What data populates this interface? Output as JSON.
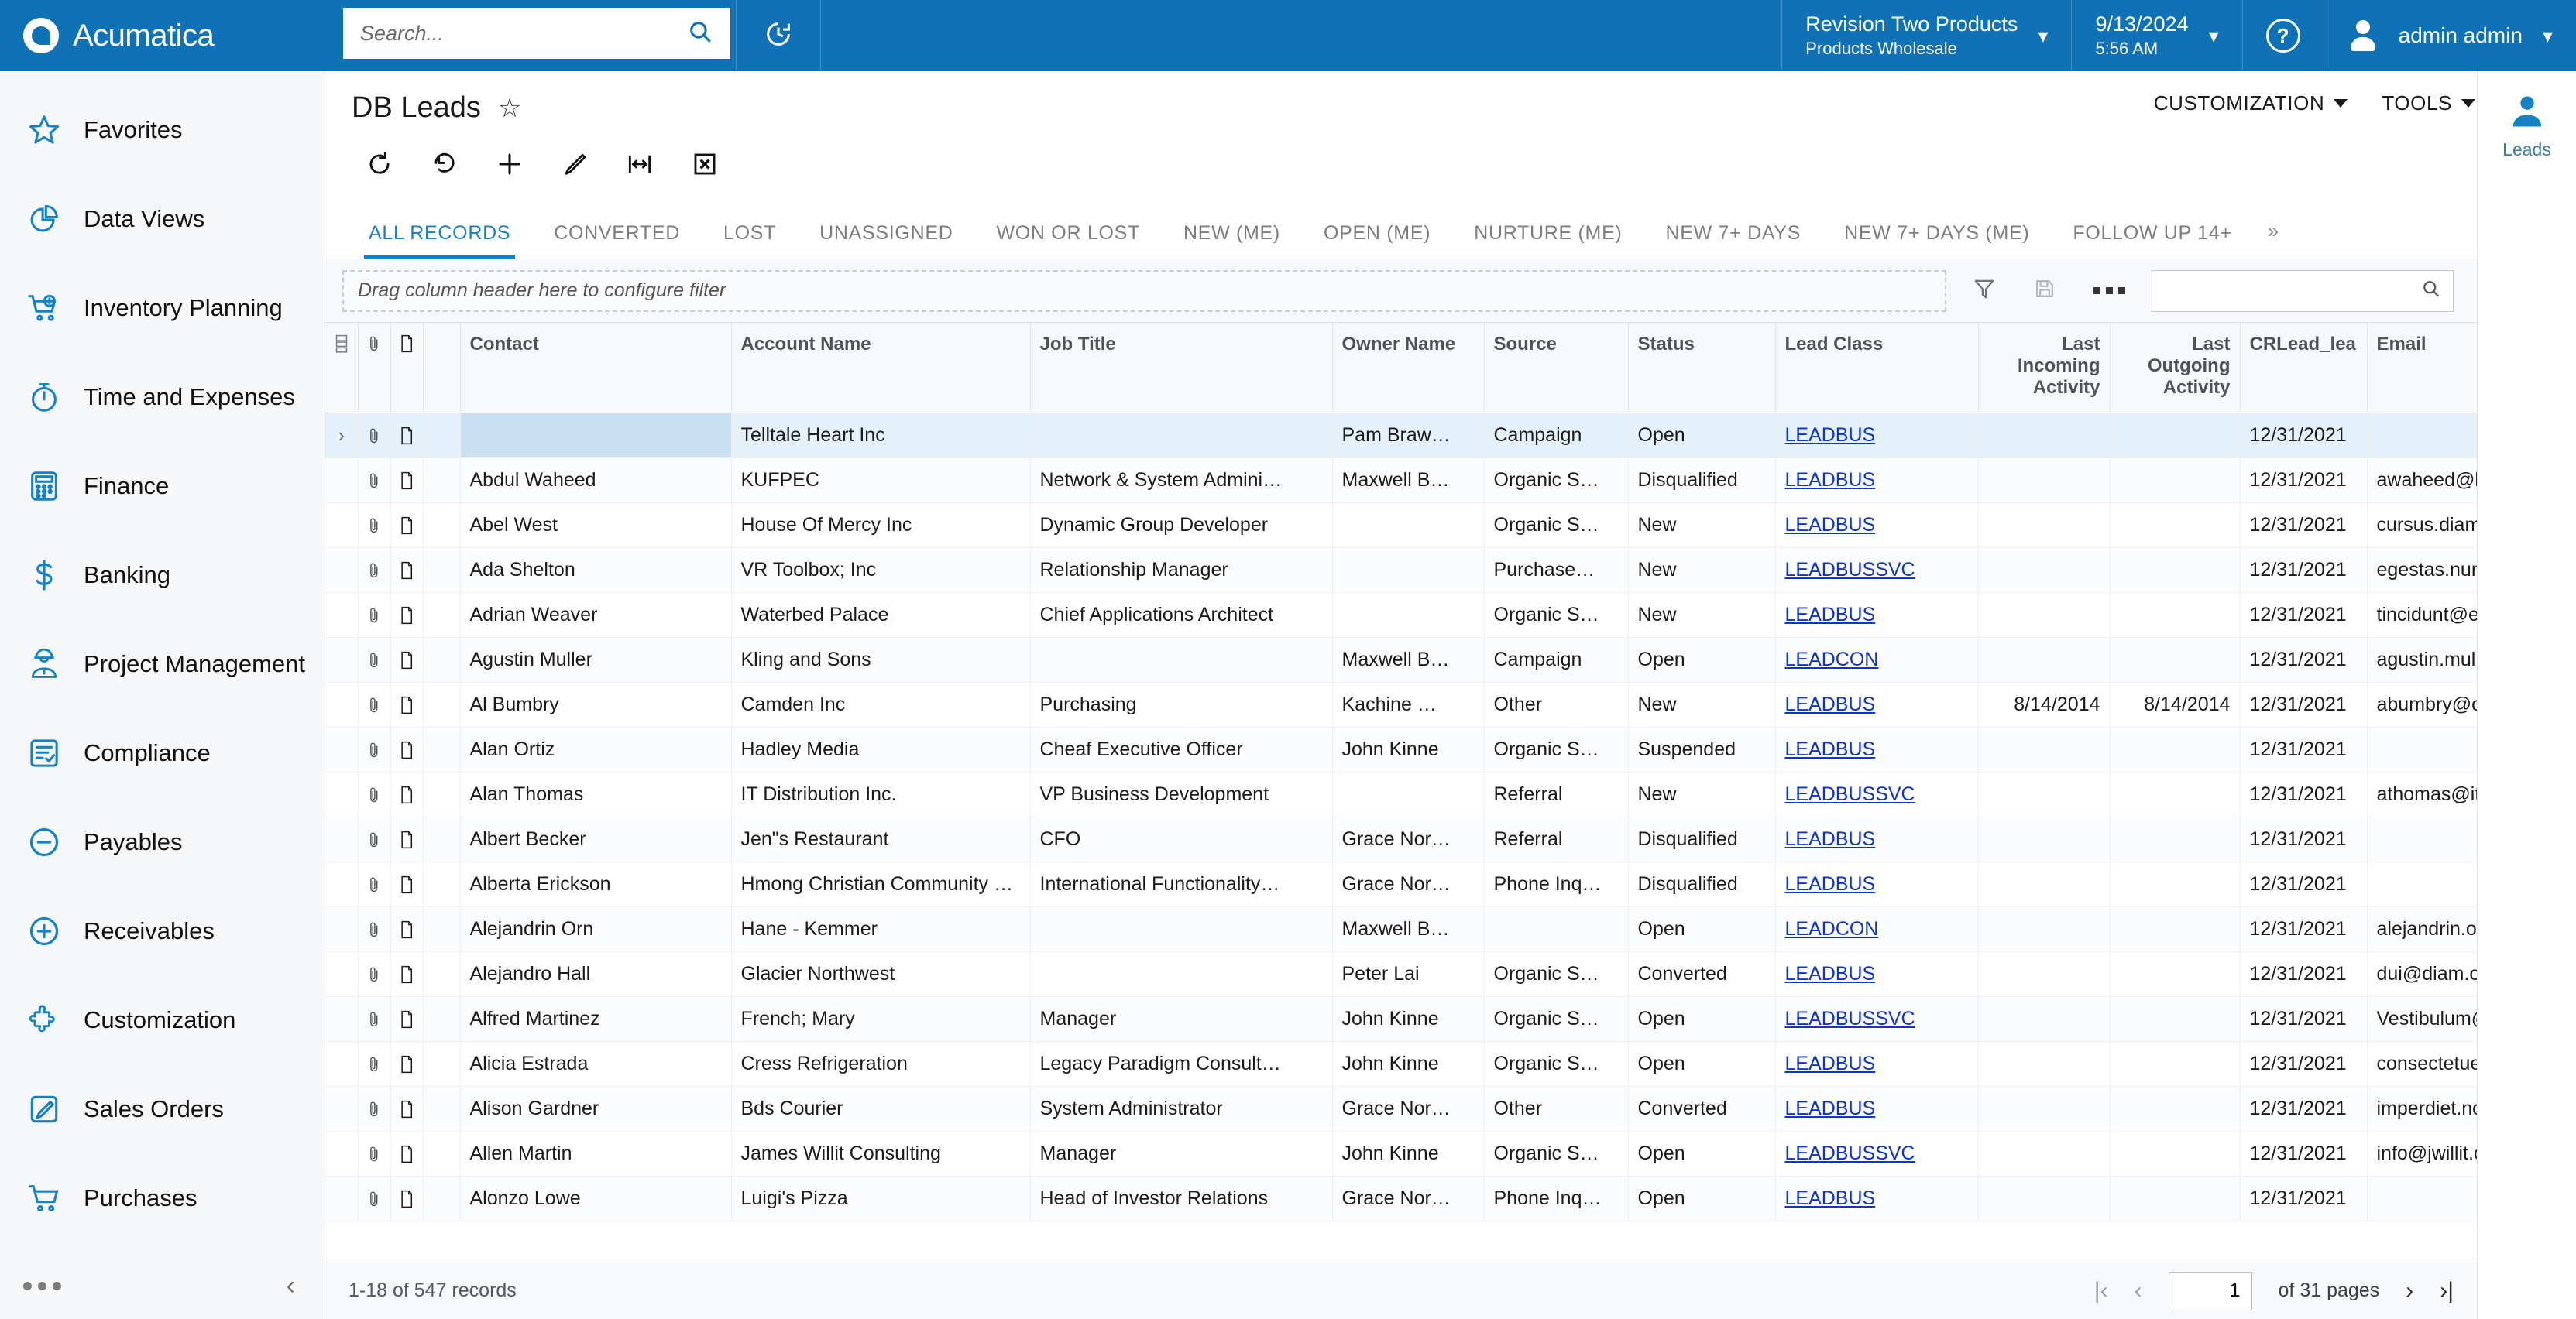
{
  "app": {
    "brand": "Acumatica",
    "logo_icon": "acumatica-logo-icon"
  },
  "topbar": {
    "search_placeholder": "Search...",
    "search_value": "",
    "search_icon": "search-icon",
    "clock_icon": "clock-icon",
    "company_name": "Revision Two Products",
    "company_branch": "Products Wholesale",
    "date": "9/13/2024",
    "time": "5:56 AM",
    "help_icon": "help-circle-icon",
    "user_name": "admin admin",
    "user_icon": "user-avatar-icon",
    "chevron_icon": "chevron-down-icon"
  },
  "sidebar": {
    "items": [
      {
        "label": "Favorites",
        "icon": "star-icon"
      },
      {
        "label": "Data Views",
        "icon": "pie-chart-icon"
      },
      {
        "label": "Inventory Planning",
        "icon": "cart-plus-icon"
      },
      {
        "label": "Time and Expenses",
        "icon": "stopwatch-icon"
      },
      {
        "label": "Finance",
        "icon": "calculator-icon"
      },
      {
        "label": "Banking",
        "icon": "dollar-sign-icon"
      },
      {
        "label": "Project Management",
        "icon": "worker-helmet-icon"
      },
      {
        "label": "Compliance",
        "icon": "checklist-icon"
      },
      {
        "label": "Payables",
        "icon": "minus-circle-icon"
      },
      {
        "label": "Receivables",
        "icon": "plus-circle-icon"
      },
      {
        "label": "Customization",
        "icon": "puzzle-piece-icon"
      },
      {
        "label": "Sales Orders",
        "icon": "pencil-square-icon"
      },
      {
        "label": "Purchases",
        "icon": "shopping-cart-icon"
      }
    ],
    "more_icon": "ellipsis-icon",
    "collapse_icon": "chevron-left-icon"
  },
  "page": {
    "title": "DB Leads",
    "favorite_icon": "star-outline-icon",
    "customization_label": "CUSTOMIZATION",
    "tools_label": "TOOLS"
  },
  "toolbar": {
    "buttons": [
      {
        "name": "refresh",
        "icon": "refresh-icon"
      },
      {
        "name": "undo",
        "icon": "undo-icon"
      },
      {
        "name": "add-new-record",
        "icon": "plus-icon"
      },
      {
        "name": "edit",
        "icon": "pencil-icon"
      },
      {
        "name": "adjust-column-width",
        "icon": "fit-width-icon"
      },
      {
        "name": "export-to-excel",
        "icon": "excel-icon"
      }
    ]
  },
  "tabs": {
    "items": [
      "ALL RECORDS",
      "CONVERTED",
      "LOST",
      "UNASSIGNED",
      "WON OR LOST",
      "NEW (ME)",
      "OPEN (ME)",
      "NURTURE (ME)",
      "NEW 7+ DAYS",
      "NEW 7+ DAYS (ME)",
      "FOLLOW UP 14+"
    ],
    "active_index": 0,
    "overflow_icon": "double-chevron-right-icon"
  },
  "filter": {
    "drop_hint": "Drag column header here to configure filter",
    "filter_icon": "funnel-icon",
    "save_icon": "save-icon",
    "more_icon": "ellipsis-icon",
    "search_value": "",
    "search_placeholder": "",
    "search_icon": "search-icon"
  },
  "grid": {
    "columns": [
      {
        "key": "settings",
        "label": "",
        "icon": "column-settings-icon",
        "mini": true
      },
      {
        "key": "files",
        "label": "",
        "icon": "paperclip-icon",
        "mini": true
      },
      {
        "key": "notes",
        "label": "",
        "icon": "note-icon",
        "mini": true
      },
      {
        "key": "contact",
        "label": "Contact",
        "align": "left"
      },
      {
        "key": "account_name",
        "label": "Account Name",
        "align": "left"
      },
      {
        "key": "job_title",
        "label": "Job Title",
        "align": "left"
      },
      {
        "key": "owner_name",
        "label": "Owner Name",
        "align": "left"
      },
      {
        "key": "source",
        "label": "Source",
        "align": "left"
      },
      {
        "key": "status",
        "label": "Status",
        "align": "left"
      },
      {
        "key": "lead_class",
        "label": "Lead Class",
        "align": "left"
      },
      {
        "key": "last_incoming",
        "label": "Last Incoming Activity",
        "align": "right"
      },
      {
        "key": "last_outgoing",
        "label": "Last Outgoing Activity",
        "align": "right"
      },
      {
        "key": "crlead",
        "label": "CRLead_lea",
        "align": "left"
      },
      {
        "key": "email",
        "label": "Email",
        "align": "left"
      }
    ],
    "rows": [
      {
        "selected": true,
        "contact": "",
        "account_name": "Telltale Heart Inc",
        "job_title": "",
        "owner_name": "Pam Braw…",
        "source": "Campaign",
        "status": "Open",
        "lead_class": "LEADBUS",
        "last_incoming": "",
        "last_outgoing": "",
        "crlead": "12/31/2021",
        "email": ""
      },
      {
        "contact": "Abdul Waheed",
        "account_name": "KUFPEC",
        "job_title": "Network & System Admini…",
        "owner_name": "Maxwell B…",
        "source": "Organic S…",
        "status": "Disqualified",
        "lead_class": "LEADBUS",
        "last_incoming": "",
        "last_outgoing": "",
        "crlead": "12/31/2021",
        "email": "awaheed@k"
      },
      {
        "contact": "Abel West",
        "account_name": "House Of Mercy Inc",
        "job_title": "Dynamic Group Developer",
        "owner_name": "",
        "source": "Organic S…",
        "status": "New",
        "lead_class": "LEADBUS",
        "last_incoming": "",
        "last_outgoing": "",
        "crlead": "12/31/2021",
        "email": "cursus.diam"
      },
      {
        "contact": "Ada Shelton",
        "account_name": "VR Toolbox; Inc",
        "job_title": "Relationship Manager",
        "owner_name": "",
        "source": "Purchase…",
        "status": "New",
        "lead_class": "LEADBUSSVC",
        "last_incoming": "",
        "last_outgoing": "",
        "crlead": "12/31/2021",
        "email": "egestas.nun"
      },
      {
        "contact": "Adrian Weaver",
        "account_name": "Waterbed Palace",
        "job_title": "Chief Applications Architect",
        "owner_name": "",
        "source": "Organic S…",
        "status": "New",
        "lead_class": "LEADBUS",
        "last_incoming": "",
        "last_outgoing": "",
        "crlead": "12/31/2021",
        "email": "tincidunt@e"
      },
      {
        "contact": "Agustin Muller",
        "account_name": "Kling and Sons",
        "job_title": "",
        "owner_name": "Maxwell B…",
        "source": "Campaign",
        "status": "Open",
        "lead_class": "LEADCON",
        "last_incoming": "",
        "last_outgoing": "",
        "crlead": "12/31/2021",
        "email": "agustin.mull"
      },
      {
        "contact": "Al Bumbry",
        "account_name": "Camden Inc",
        "job_title": "Purchasing",
        "owner_name": "Kachine …",
        "source": "Other",
        "status": "New",
        "lead_class": "LEADBUS",
        "last_incoming": "8/14/2014",
        "last_outgoing": "8/14/2014",
        "crlead": "12/31/2021",
        "email": "abumbry@c"
      },
      {
        "contact": "Alan Ortiz",
        "account_name": "Hadley Media",
        "job_title": "Cheaf Executive Officer",
        "owner_name": "John Kinne",
        "source": "Organic S…",
        "status": "Suspended",
        "lead_class": "LEADBUS",
        "last_incoming": "",
        "last_outgoing": "",
        "crlead": "12/31/2021",
        "email": ""
      },
      {
        "contact": "Alan Thomas",
        "account_name": "IT Distribution Inc.",
        "job_title": "VP Business Development",
        "owner_name": "",
        "source": "Referral",
        "status": "New",
        "lead_class": "LEADBUSSVC",
        "last_incoming": "",
        "last_outgoing": "",
        "crlead": "12/31/2021",
        "email": "athomas@it"
      },
      {
        "contact": "Albert Becker",
        "account_name": "Jen\"s Restaurant",
        "job_title": "CFO",
        "owner_name": "Grace Nor…",
        "source": "Referral",
        "status": "Disqualified",
        "lead_class": "LEADBUS",
        "last_incoming": "",
        "last_outgoing": "",
        "crlead": "12/31/2021",
        "email": ""
      },
      {
        "contact": "Alberta Erickson",
        "account_name": "Hmong Christian Community …",
        "job_title": "International Functionality…",
        "owner_name": "Grace Nor…",
        "source": "Phone Inq…",
        "status": "Disqualified",
        "lead_class": "LEADBUS",
        "last_incoming": "",
        "last_outgoing": "",
        "crlead": "12/31/2021",
        "email": ""
      },
      {
        "contact": "Alejandrin Orn",
        "account_name": "Hane - Kemmer",
        "job_title": "",
        "owner_name": "Maxwell B…",
        "source": "",
        "status": "Open",
        "lead_class": "LEADCON",
        "last_incoming": "",
        "last_outgoing": "",
        "crlead": "12/31/2021",
        "email": "alejandrin.or"
      },
      {
        "contact": "Alejandro Hall",
        "account_name": "Glacier Northwest",
        "job_title": "",
        "owner_name": "Peter Lai",
        "source": "Organic S…",
        "status": "Converted",
        "lead_class": "LEADBUS",
        "last_incoming": "",
        "last_outgoing": "",
        "crlead": "12/31/2021",
        "email": "dui@diam.o"
      },
      {
        "contact": "Alfred Martinez",
        "account_name": "French; Mary",
        "job_title": "Manager",
        "owner_name": "John Kinne",
        "source": "Organic S…",
        "status": "Open",
        "lead_class": "LEADBUSSVC",
        "last_incoming": "",
        "last_outgoing": "",
        "crlead": "12/31/2021",
        "email": "Vestibulum@"
      },
      {
        "contact": "Alicia Estrada",
        "account_name": "Cress Refrigeration",
        "job_title": "Legacy Paradigm Consult…",
        "owner_name": "John Kinne",
        "source": "Organic S…",
        "status": "Open",
        "lead_class": "LEADBUS",
        "last_incoming": "",
        "last_outgoing": "",
        "crlead": "12/31/2021",
        "email": "consectetue"
      },
      {
        "contact": "Alison Gardner",
        "account_name": "Bds Courier",
        "job_title": "System Administrator",
        "owner_name": "Grace Nor…",
        "source": "Other",
        "status": "Converted",
        "lead_class": "LEADBUS",
        "last_incoming": "",
        "last_outgoing": "",
        "crlead": "12/31/2021",
        "email": "imperdiet.no"
      },
      {
        "contact": "Allen Martin",
        "account_name": "James Willit Consulting",
        "job_title": "Manager",
        "owner_name": "John Kinne",
        "source": "Organic S…",
        "status": "Open",
        "lead_class": "LEADBUSSVC",
        "last_incoming": "",
        "last_outgoing": "",
        "crlead": "12/31/2021",
        "email": "info@jwillit.c"
      },
      {
        "contact": "Alonzo Lowe",
        "account_name": "Luigi's Pizza",
        "job_title": "Head of Investor Relations",
        "owner_name": "Grace Nor…",
        "source": "Phone Inq…",
        "status": "Open",
        "lead_class": "LEADBUS",
        "last_incoming": "",
        "last_outgoing": "",
        "crlead": "12/31/2021",
        "email": ""
      }
    ]
  },
  "footer": {
    "record_count": "1-18 of 547 records",
    "page_number": "1",
    "page_total": "of 31 pages",
    "first_icon": "first-page-icon",
    "prev_icon": "prev-page-icon",
    "next_icon": "next-page-icon",
    "last_icon": "last-page-icon"
  },
  "right_rail": {
    "label": "Leads",
    "icon": "leads-person-icon"
  },
  "colors": {
    "brand_blue": "#1072b5",
    "accent_blue": "#1a7fc1",
    "link_blue": "#0e34c8",
    "selected_row": "#e4f0fa"
  }
}
